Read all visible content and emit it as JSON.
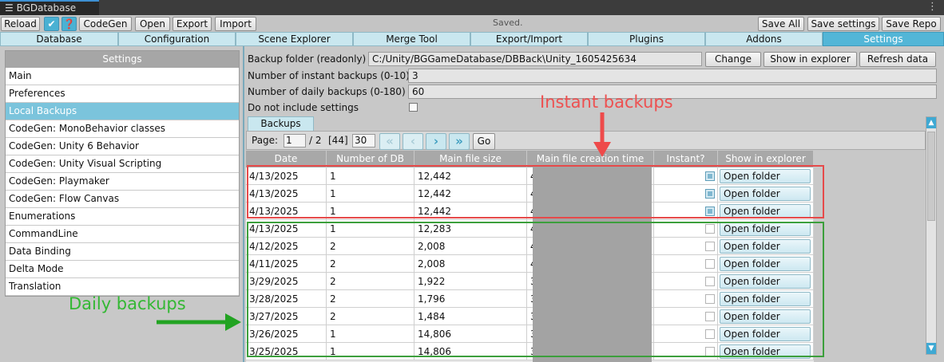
{
  "window": {
    "title": "BGDatabase",
    "menu_icon": "kebab-menu-icon"
  },
  "toolbar": {
    "reload": "Reload",
    "check_icon": "✔",
    "help_icon": "❓",
    "codegen": "CodeGen",
    "open": "Open",
    "export": "Export",
    "import": "Import",
    "status": "Saved.",
    "save_all": "Save All",
    "save_settings": "Save settings",
    "save_repo": "Save Repo"
  },
  "tabs": [
    {
      "label": "Database"
    },
    {
      "label": "Configuration"
    },
    {
      "label": "Scene Explorer"
    },
    {
      "label": "Merge Tool"
    },
    {
      "label": "Export/Import"
    },
    {
      "label": "Plugins"
    },
    {
      "label": "Addons"
    },
    {
      "label": "Settings",
      "active": true
    }
  ],
  "sidebar": {
    "title": "Settings",
    "items": [
      {
        "label": "Main"
      },
      {
        "label": "Preferences"
      },
      {
        "label": "Local Backups",
        "selected": true
      },
      {
        "label": "CodeGen: MonoBehavior classes"
      },
      {
        "label": "CodeGen: Unity 6 Behavior"
      },
      {
        "label": "CodeGen: Unity Visual Scripting"
      },
      {
        "label": "CodeGen: Playmaker"
      },
      {
        "label": "CodeGen: Flow Canvas"
      },
      {
        "label": "Enumerations"
      },
      {
        "label": "CommandLine"
      },
      {
        "label": "Data Binding"
      },
      {
        "label": "Delta Mode"
      },
      {
        "label": "Translation"
      }
    ]
  },
  "settings": {
    "backup_folder_label": "Backup folder (readonly)",
    "backup_folder_value": "C:/Unity/BGGameDatabase/DBBack\\Unity_1605425634",
    "change": "Change",
    "show_in_explorer": "Show in explorer",
    "refresh_data": "Refresh data",
    "instant_label": "Number of instant backups (0-10)",
    "instant_value": "3",
    "daily_label": "Number of daily backups (0-180)",
    "daily_value": "60",
    "no_settings_label": "Do not include settings",
    "no_settings_checked": false
  },
  "backups": {
    "tab_label": "Backups",
    "pager": {
      "page_label": "Page:",
      "page": "1",
      "total_pages": "/ 2",
      "total_count": "[44]",
      "page_size": "30",
      "first_icon": "double-chevron-left-icon",
      "prev_icon": "chevron-left-icon",
      "next_icon": "chevron-right-icon",
      "last_icon": "double-chevron-right-icon",
      "go": "Go"
    },
    "columns": [
      "Date",
      "Number of DB files",
      "Main file size",
      "Main file creation time",
      "Instant?",
      "Show in explorer"
    ],
    "open_label": "Open folder",
    "rows": [
      {
        "date": "4/13/2025",
        "files": "1",
        "size": "12,442",
        "ctime": "4",
        "instant": true
      },
      {
        "date": "4/13/2025",
        "files": "1",
        "size": "12,442",
        "ctime": "4",
        "instant": true
      },
      {
        "date": "4/13/2025",
        "files": "1",
        "size": "12,442",
        "ctime": "4",
        "instant": true
      },
      {
        "date": "4/13/2025",
        "files": "1",
        "size": "12,283",
        "ctime": "4",
        "instant": false
      },
      {
        "date": "4/12/2025",
        "files": "2",
        "size": "2,008",
        "ctime": "4",
        "instant": false
      },
      {
        "date": "4/11/2025",
        "files": "2",
        "size": "2,008",
        "ctime": "4",
        "instant": false
      },
      {
        "date": "3/29/2025",
        "files": "2",
        "size": "1,922",
        "ctime": "3",
        "instant": false
      },
      {
        "date": "3/28/2025",
        "files": "2",
        "size": "1,796",
        "ctime": "3",
        "instant": false
      },
      {
        "date": "3/27/2025",
        "files": "2",
        "size": "1,484",
        "ctime": "3",
        "instant": false
      },
      {
        "date": "3/26/2025",
        "files": "1",
        "size": "14,806",
        "ctime": "3",
        "instant": false
      },
      {
        "date": "3/25/2025",
        "files": "1",
        "size": "14,806",
        "ctime": "3",
        "instant": false
      }
    ]
  },
  "annotations": {
    "instant": "Instant backups",
    "daily": "Daily backups",
    "red": "#e64a4a",
    "green": "#3c9f3c"
  },
  "colors": {
    "accent": "#53b6d7",
    "tab_inactive": "#c9e7ef",
    "header_gray": "#a8a8a8"
  }
}
